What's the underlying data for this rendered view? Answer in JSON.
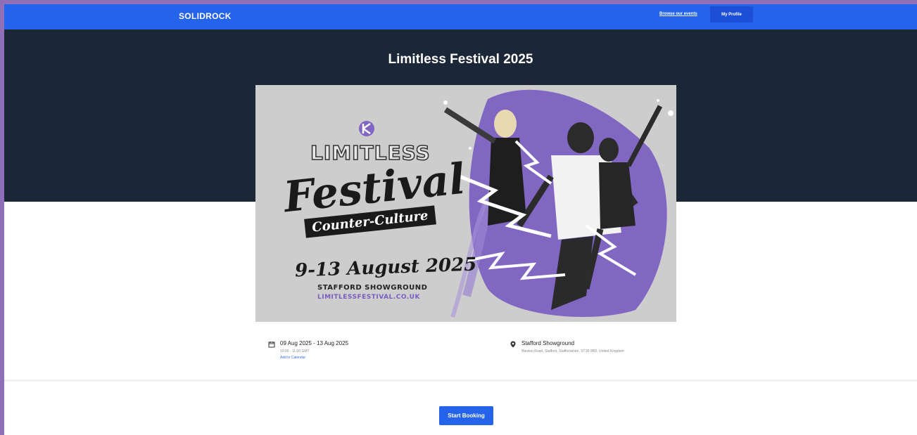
{
  "header": {
    "brand": "SOLIDROCK",
    "browse_link": "Browse our events",
    "profile_button": "My Profile"
  },
  "event": {
    "title": "Limitless Festival 2025",
    "date_range": "09 Aug 2025 - 13 Aug 2025",
    "time_range": "10:00 - 11:00 GMT",
    "add_to_calendar": "Add to Calendar",
    "location_name": "Stafford Showground",
    "location_address": "Weston Road, Stafford, Staffordshire, ST18 0BD, United Kingdom"
  },
  "banner": {
    "line1": "LIMITLESS",
    "line2": "Festival",
    "line3": "Counter-Culture",
    "dates": "9-13 August 2025",
    "venue": "STAFFORD SHOWGROUND",
    "url": "LIMITLESSFESTIVAL.CO.UK"
  },
  "actions": {
    "start_booking": "Start Booking"
  },
  "colors": {
    "nav_blue": "#2563eb",
    "hero_dark": "#1b2637",
    "accent_purple": "#7c5cc4"
  }
}
